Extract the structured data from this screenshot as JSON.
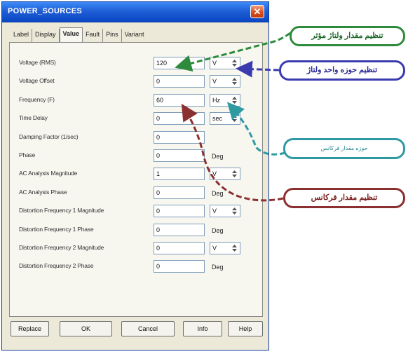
{
  "window": {
    "title": "POWER_SOURCES",
    "close_glyph": "✕"
  },
  "tabs": [
    "Label",
    "Display",
    "Value",
    "Fault",
    "Pins",
    "Variant"
  ],
  "active_tab": "Value",
  "rows": [
    {
      "label": "Voltage (RMS)",
      "value": "120",
      "unit": "V",
      "unit_kind": "dropdown"
    },
    {
      "label": "Voltage Offset",
      "value": "0",
      "unit": "V",
      "unit_kind": "dropdown"
    },
    {
      "label": "Frequency (F)",
      "value": "60",
      "unit": "Hz",
      "unit_kind": "dropdown"
    },
    {
      "label": "Time Delay",
      "value": "0",
      "unit": "sec",
      "unit_kind": "dropdown"
    },
    {
      "label": "Damping Factor (1/sec)",
      "value": "0",
      "unit": "",
      "unit_kind": "none"
    },
    {
      "label": "Phase",
      "value": "0",
      "unit": "Deg",
      "unit_kind": "text"
    },
    {
      "label": "AC Analysis Magnitude",
      "value": "1",
      "unit": "V",
      "unit_kind": "dropdown"
    },
    {
      "label": "AC Analysis Phase",
      "value": "0",
      "unit": "Deg",
      "unit_kind": "text"
    },
    {
      "label": "Distortion Frequency 1 Magnitude",
      "value": "0",
      "unit": "V",
      "unit_kind": "dropdown"
    },
    {
      "label": "Distortion Frequency 1 Phase",
      "value": "0",
      "unit": "Deg",
      "unit_kind": "text"
    },
    {
      "label": "Distortion Frequency 2 Magnitude",
      "value": "0",
      "unit": "V",
      "unit_kind": "dropdown"
    },
    {
      "label": "Distortion Frequency 2 Phase",
      "value": "0",
      "unit": "Deg",
      "unit_kind": "text"
    }
  ],
  "buttons": [
    "Replace",
    "OK",
    "Cancel",
    "Info",
    "Help"
  ],
  "callouts": {
    "voltage_value": "تنظیم مقدار ولتاژ مؤثر",
    "voltage_unit": "تنظیم حوزه واحد ولتاژ",
    "frequency_unit": "حوزه مقدار فرکانس",
    "frequency_value": "تنظیم مقدار فرکانس"
  },
  "colors": {
    "green": "#2e8b3d",
    "blue": "#3b3bb0",
    "teal": "#2f9aa2",
    "maroon": "#8b3030",
    "title_bar": "#1f5fd6"
  }
}
